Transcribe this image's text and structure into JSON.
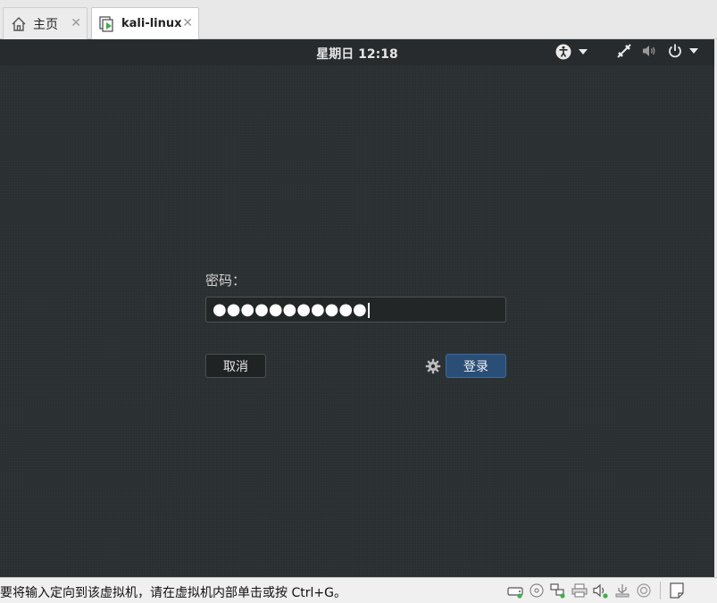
{
  "tabs": [
    {
      "label": "主页",
      "icon": "home-icon",
      "active": false
    },
    {
      "label": "kali-linux",
      "icon": "vm-icon",
      "active": true
    }
  ],
  "tab_close_glyph": "✕",
  "topbar": {
    "clock": "星期日 12:18",
    "icons": [
      "accessibility-icon",
      "chevron-down-icon",
      "network-icon",
      "volume-icon",
      "power-icon",
      "chevron-down-icon"
    ]
  },
  "login": {
    "password_label": "密码：",
    "password_value": "●●●●●●●●●●●",
    "cancel_label": "取消",
    "login_label": "登录",
    "settings_icon": "gear-icon"
  },
  "statusbar": {
    "message": "要将输入定向到该虚拟机，请在虚拟机内部单击或按 Ctrl+G。",
    "icons": [
      "hard-disk-icon",
      "cd-icon",
      "network-adapter-icon",
      "printer-icon",
      "sound-icon",
      "usb-icon",
      "display-icon",
      "message-icon"
    ]
  },
  "colors": {
    "vm_bg": "#2a2f31",
    "login_button": "#2b4e77",
    "accent_green": "#3cb04a"
  }
}
